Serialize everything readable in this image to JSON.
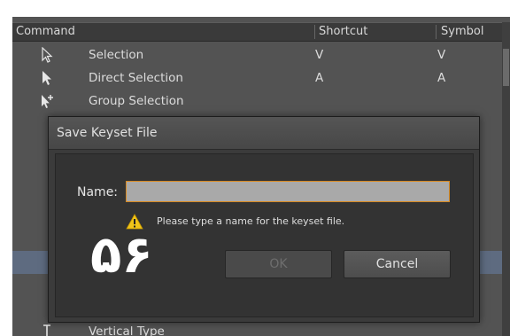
{
  "panel": {
    "columns": {
      "command": "Command",
      "shortcut": "Shortcut",
      "symbol": "Symbol"
    },
    "rows": [
      {
        "icon": "selection-arrow-icon",
        "name": "Selection",
        "shortcut": "V",
        "symbol": "V"
      },
      {
        "icon": "direct-selection-arrow-icon",
        "name": "Direct Selection",
        "shortcut": "A",
        "symbol": "A"
      },
      {
        "icon": "group-selection-arrow-icon",
        "name": "Group Selection",
        "shortcut": "",
        "symbol": ""
      },
      {
        "icon": "vertical-type-icon",
        "name": "Vertical Type",
        "shortcut": "",
        "symbol": ""
      }
    ]
  },
  "dialog": {
    "title": "Save Keyset File",
    "name_label": "Name:",
    "name_value": "",
    "warning_icon": "warning-triangle-icon",
    "warning_text": "Please type a name for the keyset file.",
    "ok_label": "OK",
    "cancel_label": "Cancel"
  },
  "overlay": {
    "number": "۵۶"
  },
  "colors": {
    "panel_bg": "#535353",
    "dialog_bg": "#3b3b3b",
    "input_border": "#d78a22",
    "warning_yellow": "#f0c419",
    "highlight_row": "#5e6b80"
  }
}
